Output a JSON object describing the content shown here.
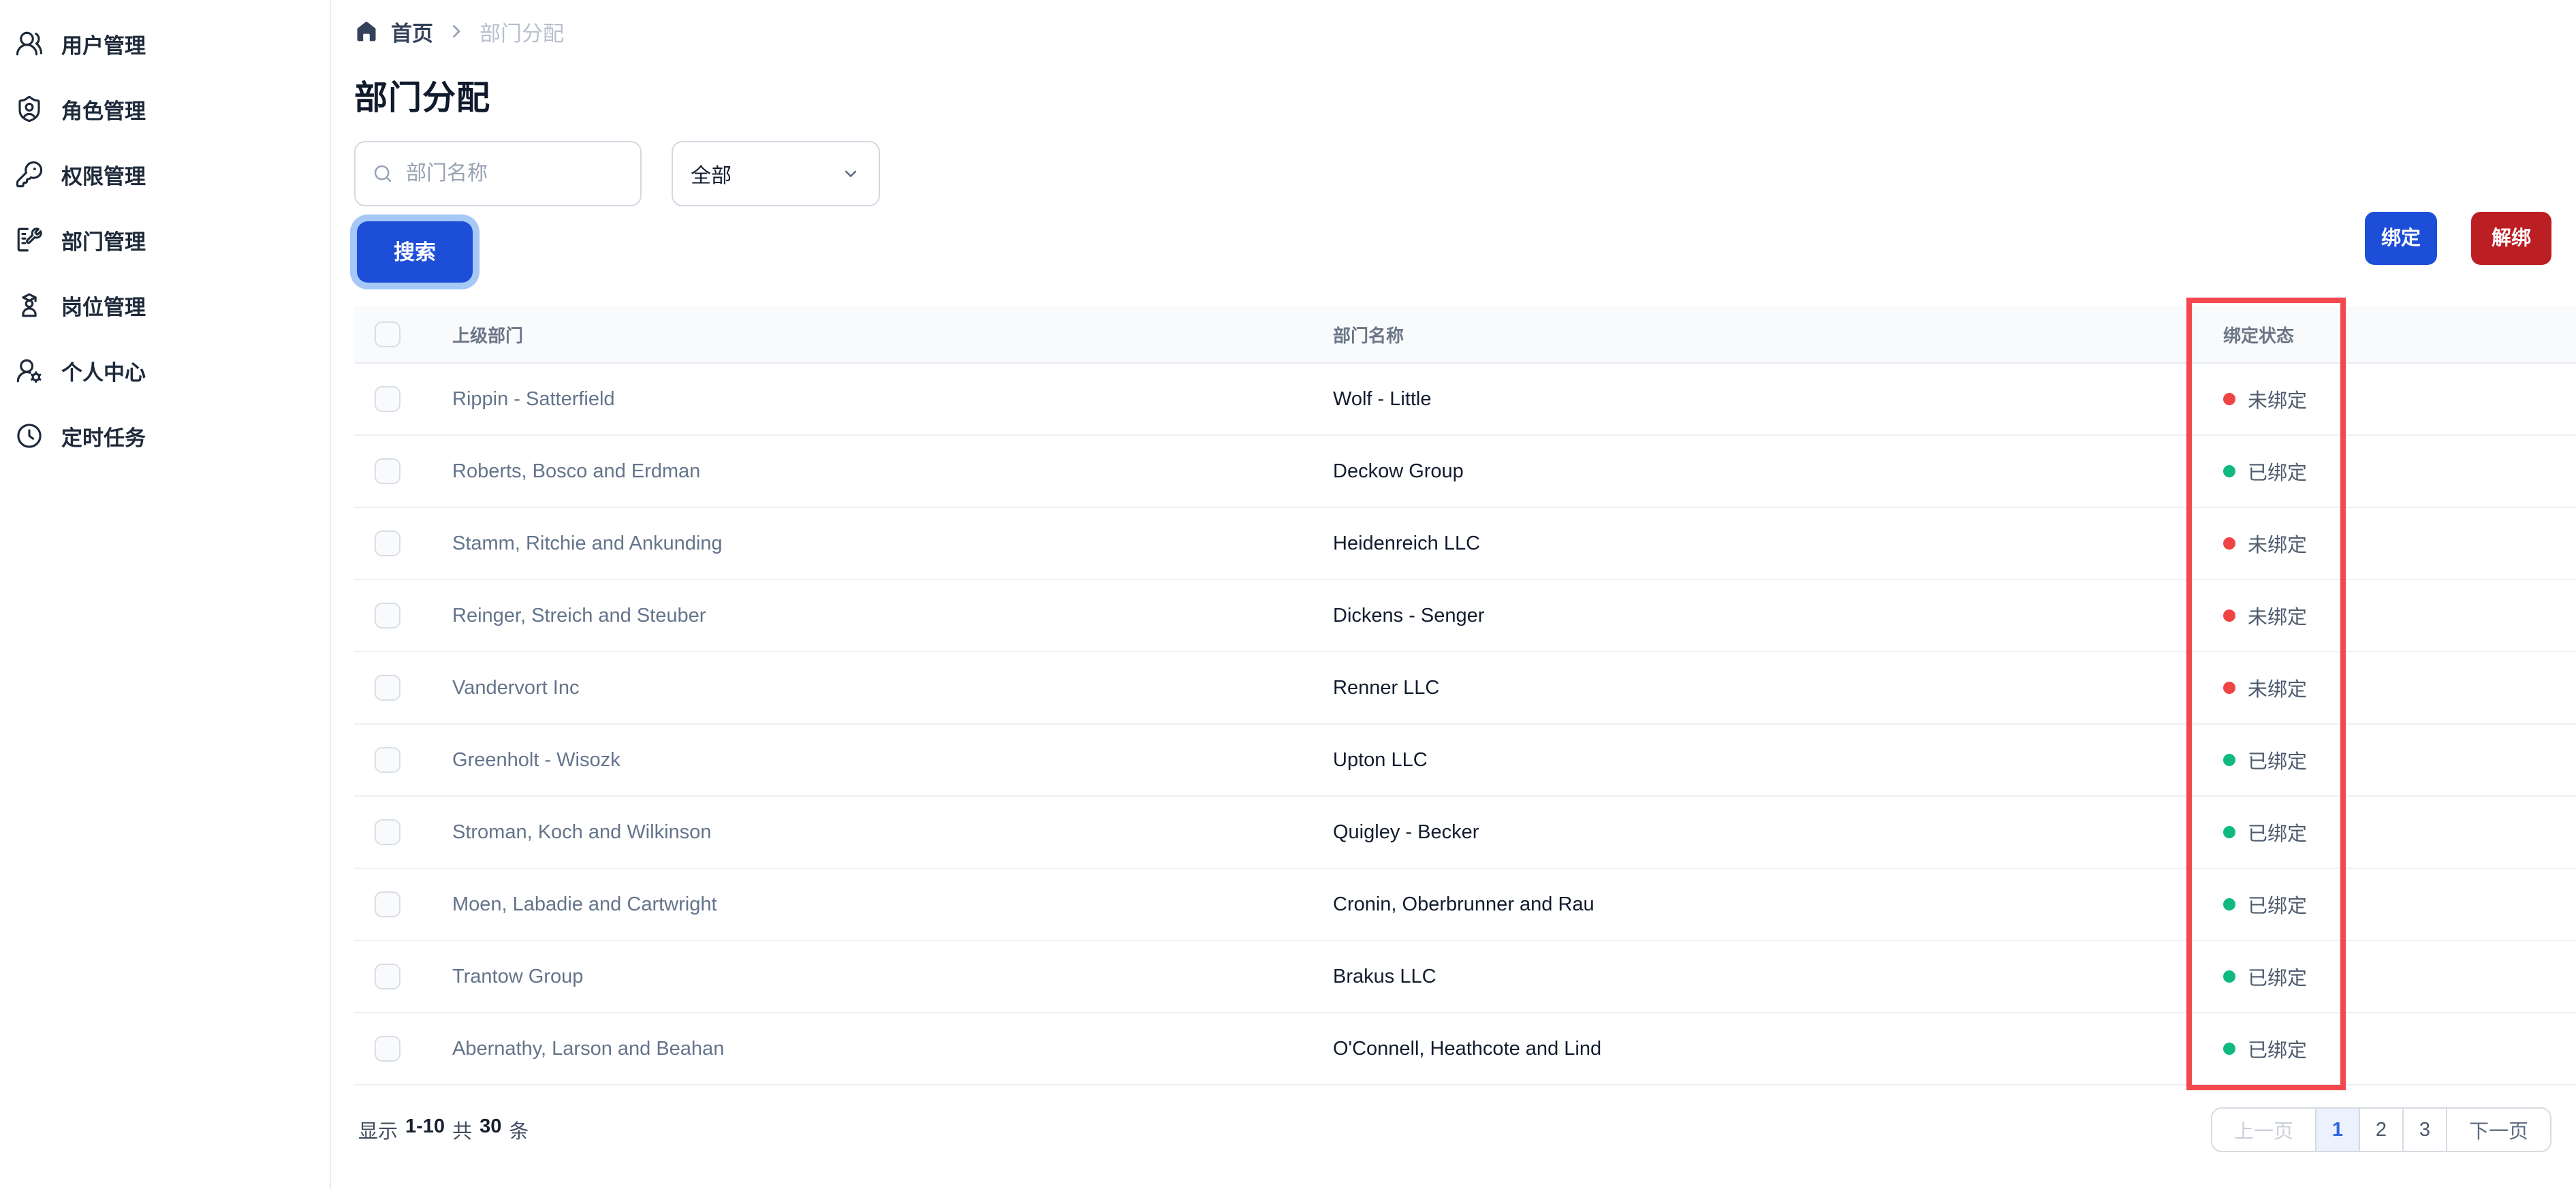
{
  "sidebar": {
    "items": [
      {
        "label": "用户管理",
        "icon": "users-icon"
      },
      {
        "label": "角色管理",
        "icon": "shield-user-icon"
      },
      {
        "label": "权限管理",
        "icon": "key-icon"
      },
      {
        "label": "部门管理",
        "icon": "building-wrench-icon"
      },
      {
        "label": "岗位管理",
        "icon": "graduate-user-icon"
      },
      {
        "label": "个人中心",
        "icon": "user-gear-icon"
      },
      {
        "label": "定时任务",
        "icon": "clock-icon"
      }
    ]
  },
  "breadcrumb": {
    "home": "首页",
    "current": "部门分配"
  },
  "page": {
    "title": "部门分配"
  },
  "filters": {
    "search_placeholder": "部门名称",
    "select_value": "全部",
    "search_button": "搜索"
  },
  "actions": {
    "bind": "绑定",
    "unbind": "解绑"
  },
  "table": {
    "headers": {
      "parent": "上级部门",
      "name": "部门名称",
      "status": "绑定状态"
    },
    "rows": [
      {
        "parent": "Rippin - Satterfield",
        "name": "Wolf - Little",
        "bound": false,
        "status": "未绑定"
      },
      {
        "parent": "Roberts, Bosco and Erdman",
        "name": "Deckow Group",
        "bound": true,
        "status": "已绑定"
      },
      {
        "parent": "Stamm, Ritchie and Ankunding",
        "name": "Heidenreich LLC",
        "bound": false,
        "status": "未绑定"
      },
      {
        "parent": "Reinger, Streich and Steuber",
        "name": "Dickens - Senger",
        "bound": false,
        "status": "未绑定"
      },
      {
        "parent": "Vandervort Inc",
        "name": "Renner LLC",
        "bound": false,
        "status": "未绑定"
      },
      {
        "parent": "Greenholt - Wisozk",
        "name": "Upton LLC",
        "bound": true,
        "status": "已绑定"
      },
      {
        "parent": "Stroman, Koch and Wilkinson",
        "name": "Quigley - Becker",
        "bound": true,
        "status": "已绑定"
      },
      {
        "parent": "Moen, Labadie and Cartwright",
        "name": "Cronin, Oberbrunner and Rau",
        "bound": true,
        "status": "已绑定"
      },
      {
        "parent": "Trantow Group",
        "name": "Brakus LLC",
        "bound": true,
        "status": "已绑定"
      },
      {
        "parent": "Abernathy, Larson and Beahan",
        "name": "O'Connell, Heathcote and Lind",
        "bound": true,
        "status": "已绑定"
      }
    ]
  },
  "pagination": {
    "summary_prefix": "显示",
    "range": "1-10",
    "total_join": "共",
    "total": "30",
    "unit": "条",
    "prev": "上一页",
    "pages": [
      "1",
      "2",
      "3"
    ],
    "active_page": "1",
    "next": "下一页"
  },
  "colors": {
    "primary": "#1d4ed8",
    "danger": "#bb1f24",
    "highlight": "#f4484f",
    "bound": "#10b981",
    "unbound": "#ef4444",
    "ring": "#a5c8f7",
    "page_active": "#2b65e2"
  }
}
